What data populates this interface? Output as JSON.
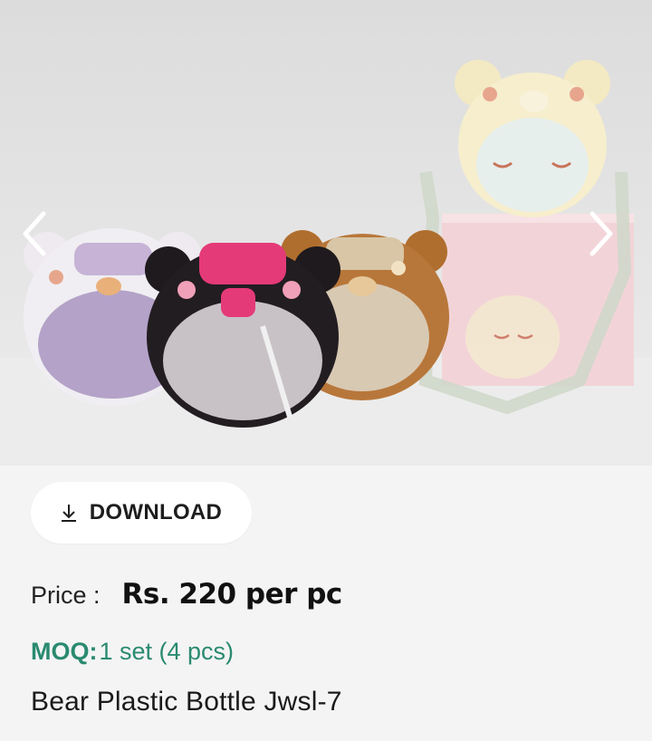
{
  "gallery": {
    "image_alt": "Bear Plastic Bottle Jwsl-7",
    "prev_icon": "chevron-left-icon",
    "next_icon": "chevron-right-icon"
  },
  "actions": {
    "download_label": "DOWNLOAD",
    "download_icon": "download-icon"
  },
  "product": {
    "price_label": "Price :",
    "price_value": "Rs. 220 per pc",
    "moq_label": "MOQ:",
    "moq_value": "1 set (4 pcs)",
    "name": "Bear Plastic Bottle Jwsl-7"
  },
  "colors": {
    "moq": "#2a8a70",
    "background": "#f4f4f4",
    "button": "#ffffff"
  }
}
